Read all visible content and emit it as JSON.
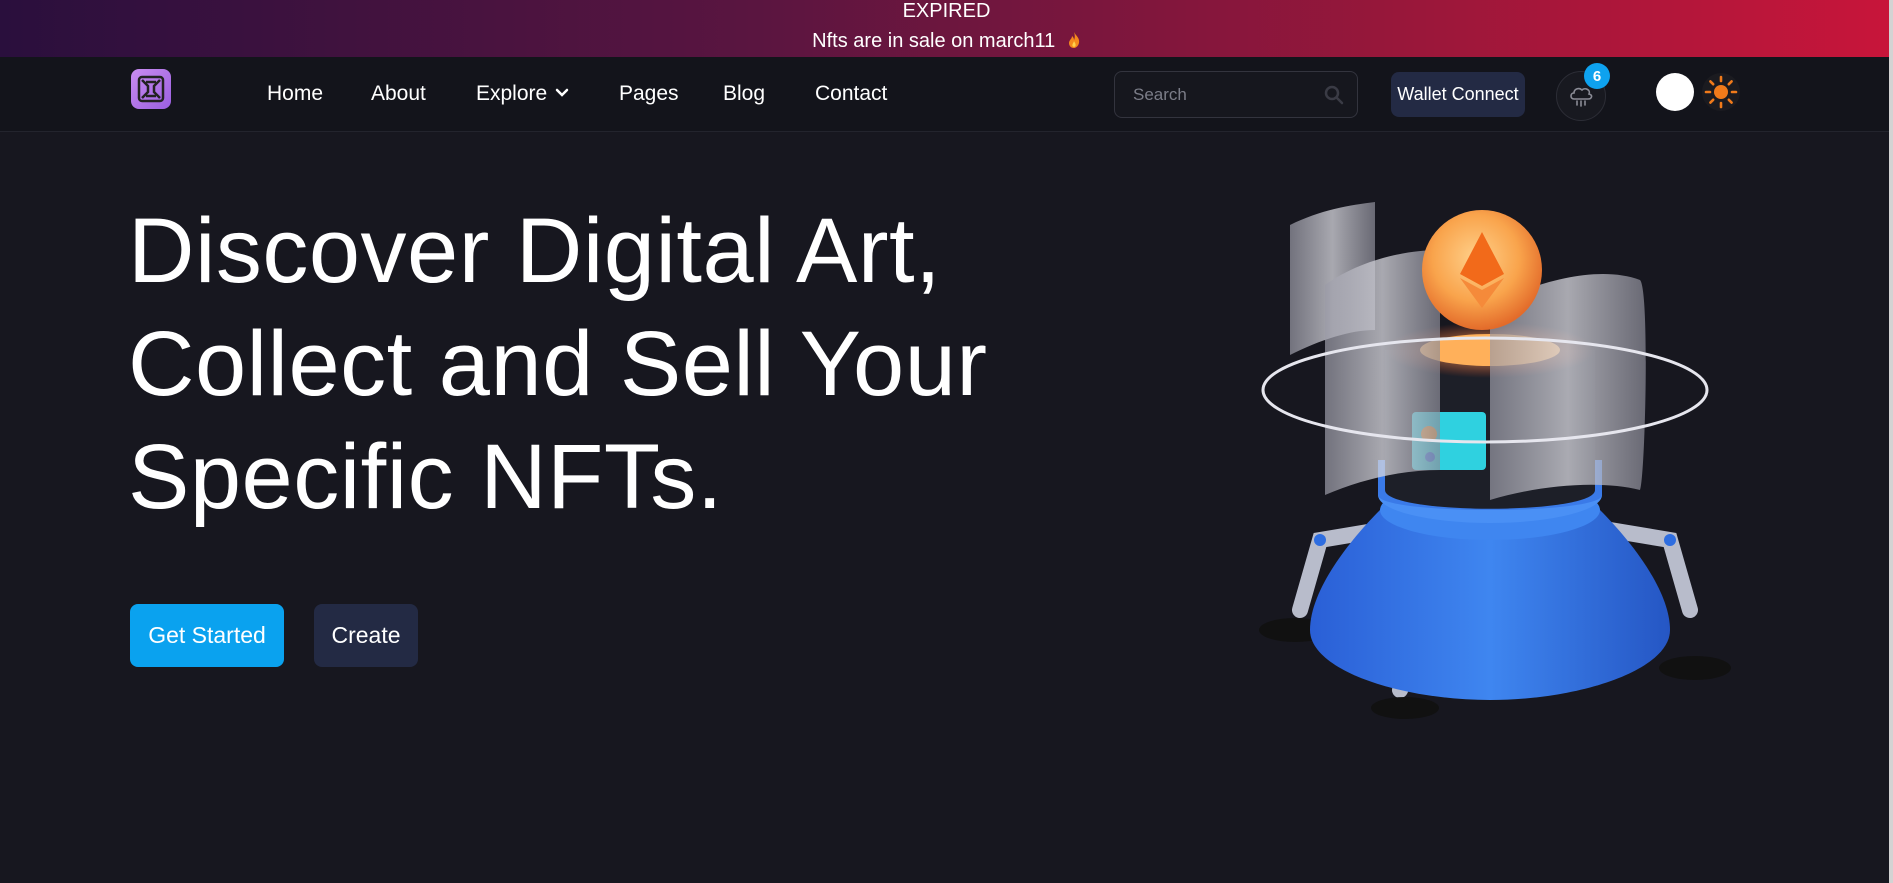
{
  "banner": {
    "status": "EXPIRED",
    "message": "Nfts are in sale on march11"
  },
  "nav": {
    "items": [
      {
        "label": "Home"
      },
      {
        "label": "About"
      },
      {
        "label": "Explore"
      },
      {
        "label": "Pages"
      },
      {
        "label": "Blog"
      },
      {
        "label": "Contact"
      }
    ],
    "search_placeholder": "Search",
    "wallet_label": "Wallet Connect",
    "notification_count": "6"
  },
  "hero": {
    "title_lines": [
      "Discover Digital Art,",
      "Collect and Sell Your",
      "Specific NFTs."
    ],
    "primary_button": "Get Started",
    "secondary_button": "Create"
  },
  "colors": {
    "accent": "#0aa2ef",
    "background": "#17171f",
    "navbar": "#13141b",
    "button_dark": "#232a44",
    "logo": "#b87ae8",
    "sun": "#f07a1a"
  },
  "icons": [
    "flame-icon",
    "logo-icon",
    "chevron-down-icon",
    "search-icon",
    "cloud-icon",
    "sun-icon"
  ]
}
